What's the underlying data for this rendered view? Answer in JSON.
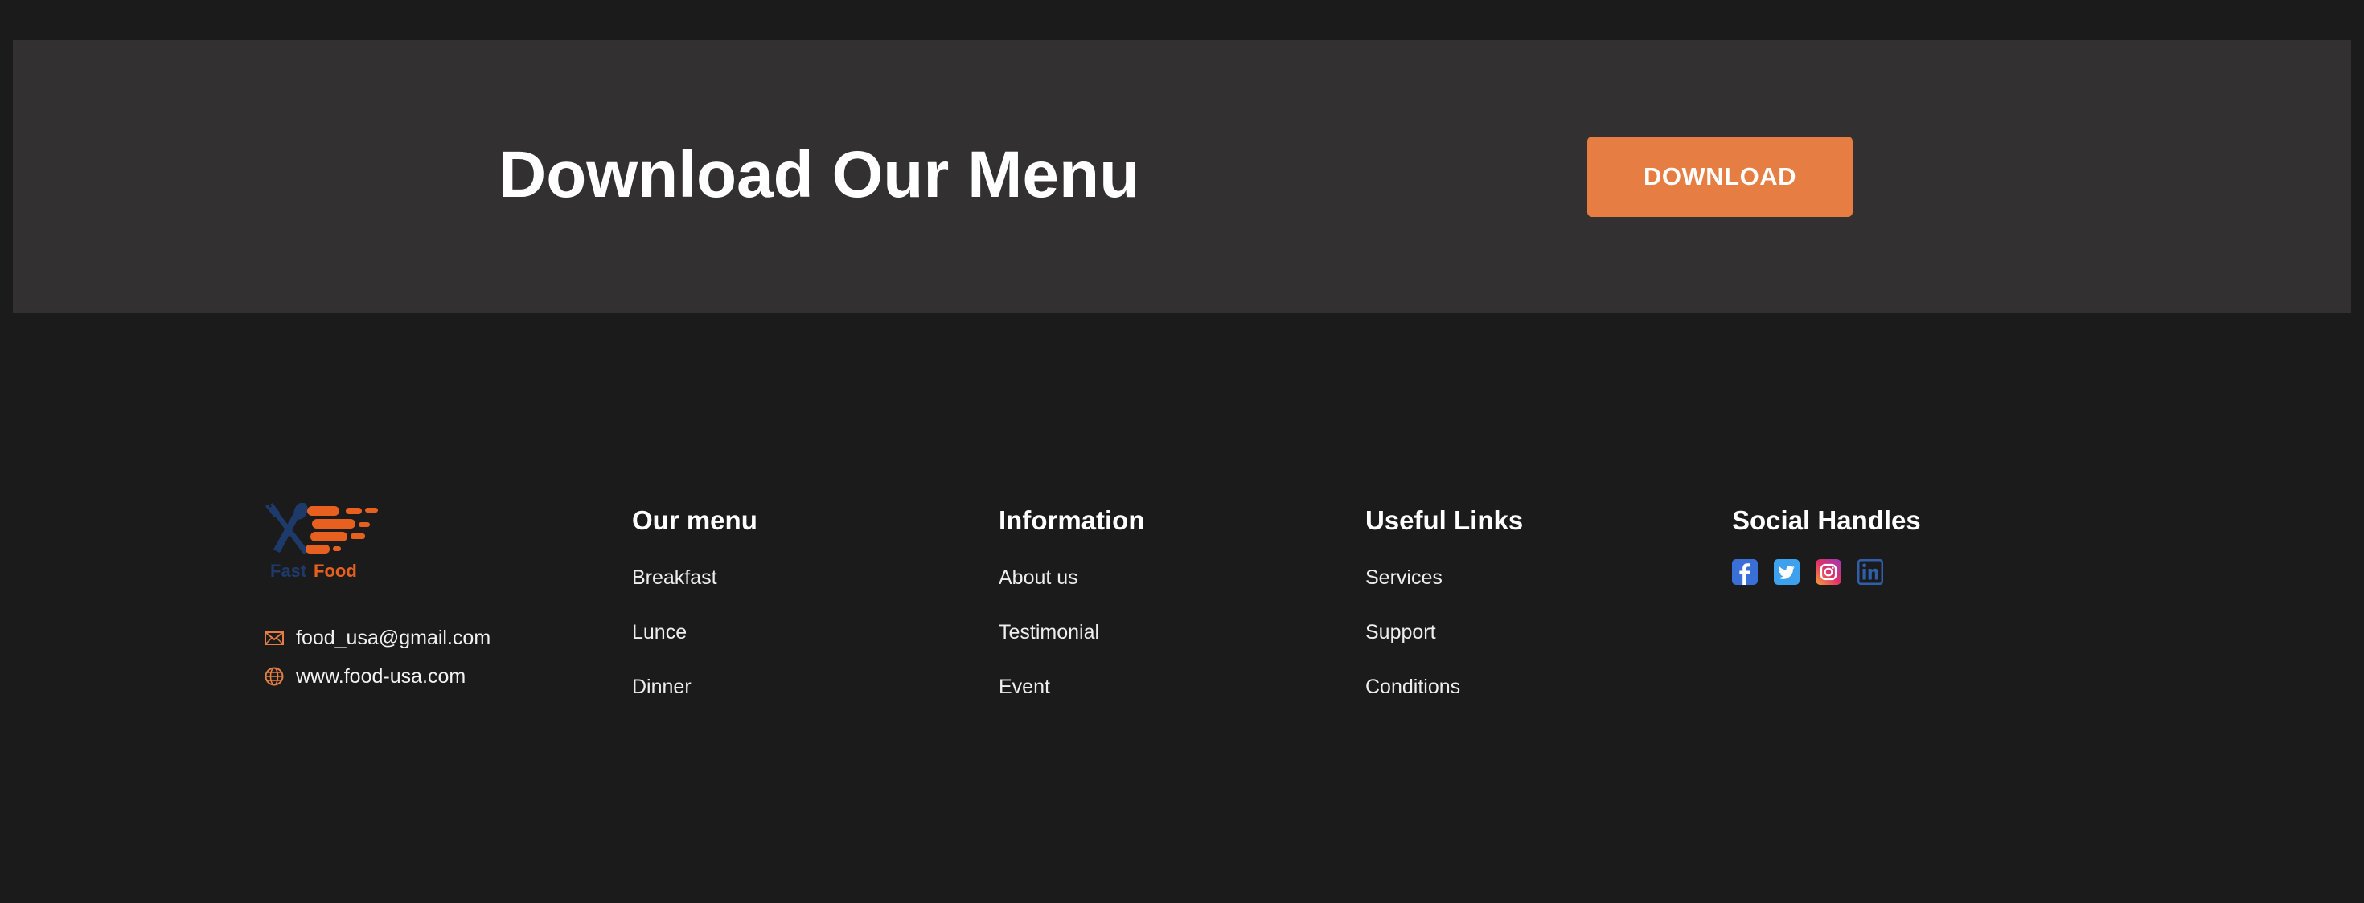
{
  "banner": {
    "title": "Download Our Menu",
    "button_label": "DOWNLOAD",
    "background": "#323031",
    "accent": "#e67e43"
  },
  "brand": {
    "logo_text_primary": "Fast",
    "logo_text_secondary": "Food",
    "logo_colors": [
      "#1e3a6b",
      "#e8601f"
    ],
    "icons": [
      "fork-knife-logo"
    ]
  },
  "contact": {
    "email": "food_usa@gmail.com",
    "email_icon": "mail-icon",
    "website": "www.food-usa.com",
    "website_icon": "globe-icon",
    "icon_color": "#e67e43"
  },
  "footer": {
    "columns": [
      {
        "heading": "Our menu",
        "items": [
          "Breakfast",
          "Lunce",
          "Dinner"
        ]
      },
      {
        "heading": "Information",
        "items": [
          "About us",
          "Testimonial",
          "Event"
        ]
      },
      {
        "heading": "Useful Links",
        "items": [
          "Services",
          "Support",
          "Conditions"
        ]
      }
    ],
    "social": {
      "heading": "Social Handles",
      "icons": [
        "facebook-icon",
        "twitter-icon",
        "instagram-icon",
        "linkedin-icon"
      ]
    }
  },
  "colors": {
    "page_background": "#1b1b1b",
    "text": "#ffffff"
  }
}
